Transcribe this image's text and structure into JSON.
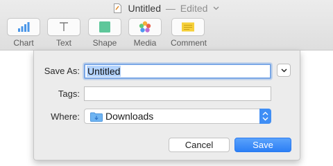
{
  "window": {
    "title": "Untitled",
    "separator": "—",
    "state": "Edited",
    "doc_icon": "pages-document-icon"
  },
  "toolbar": {
    "items": [
      {
        "label": "Chart",
        "icon": "bar-chart-icon"
      },
      {
        "label": "Text",
        "icon": "text-t-icon"
      },
      {
        "label": "Shape",
        "icon": "square-shape-icon"
      },
      {
        "label": "Media",
        "icon": "photos-flower-icon"
      },
      {
        "label": "Comment",
        "icon": "comment-note-icon"
      }
    ]
  },
  "dialog": {
    "save_as_label": "Save As:",
    "save_as_value": "Untitled",
    "tags_label": "Tags:",
    "tags_value": "",
    "where_label": "Where:",
    "where_value": "Downloads",
    "cancel_label": "Cancel",
    "save_label": "Save"
  },
  "colors": {
    "accent": "#2c7ff5",
    "selection": "#b3d3fd",
    "focus_ring": "#7aa7e6",
    "sheet_bg": "#ececec"
  }
}
